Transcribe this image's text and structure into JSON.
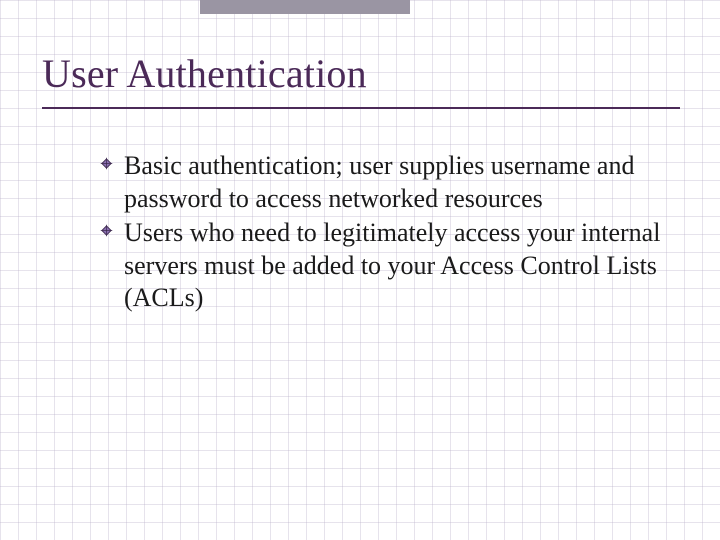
{
  "slide": {
    "title": "User Authentication",
    "bullets": [
      {
        "text": "Basic authentication; user supplies username and password to access networked resources"
      },
      {
        "text": "Users who need to legitimately access your internal servers must be added to your Access Control Lists (ACLs)"
      }
    ]
  },
  "theme": {
    "title_color": "#4b2a58",
    "bullet_color": "#7a5a9c",
    "grid_color": "rgba(185,175,200,0.35)"
  }
}
